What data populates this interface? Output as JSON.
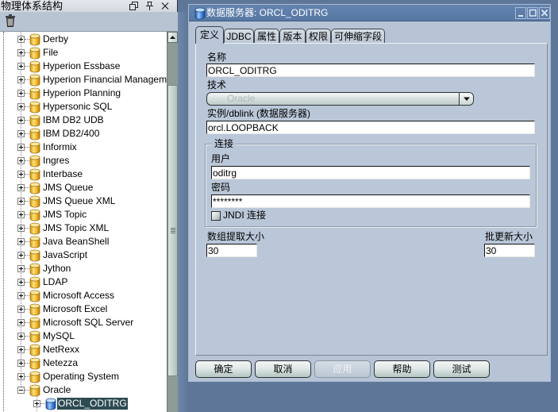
{
  "colors": {
    "desktop_bg": "#5e7799",
    "dialog_bg": "#b6c4d6",
    "title_bar": "#5878a4",
    "selection_bg": "#2c4a52",
    "technology_icon": "#f0b428",
    "data_server_icon": "#3c78d8"
  },
  "left_panel": {
    "title": "物理体系结构",
    "header_icons": {
      "restore": "restore-window-icon",
      "pin": "pin-icon",
      "close": "close-icon"
    },
    "toolbar": {
      "delete": "trash-icon"
    },
    "tree": {
      "items": [
        {
          "label": "Derby",
          "level": 1,
          "expander": "plus",
          "icon": "technology-icon"
        },
        {
          "label": "File",
          "level": 1,
          "expander": "plus",
          "icon": "technology-icon"
        },
        {
          "label": "Hyperion Essbase",
          "level": 1,
          "expander": "plus",
          "icon": "technology-icon"
        },
        {
          "label": "Hyperion Financial Management",
          "level": 1,
          "expander": "plus",
          "icon": "technology-icon"
        },
        {
          "label": "Hyperion Planning",
          "level": 1,
          "expander": "plus",
          "icon": "technology-icon"
        },
        {
          "label": "Hypersonic SQL",
          "level": 1,
          "expander": "plus",
          "icon": "technology-icon"
        },
        {
          "label": "IBM DB2 UDB",
          "level": 1,
          "expander": "plus",
          "icon": "technology-icon"
        },
        {
          "label": "IBM DB2/400",
          "level": 1,
          "expander": "plus",
          "icon": "technology-icon"
        },
        {
          "label": "Informix",
          "level": 1,
          "expander": "plus",
          "icon": "technology-icon"
        },
        {
          "label": "Ingres",
          "level": 1,
          "expander": "plus",
          "icon": "technology-icon"
        },
        {
          "label": "Interbase",
          "level": 1,
          "expander": "plus",
          "icon": "technology-icon"
        },
        {
          "label": "JMS Queue",
          "level": 1,
          "expander": "plus",
          "icon": "technology-icon"
        },
        {
          "label": "JMS Queue XML",
          "level": 1,
          "expander": "plus",
          "icon": "technology-icon"
        },
        {
          "label": "JMS Topic",
          "level": 1,
          "expander": "plus",
          "icon": "technology-icon"
        },
        {
          "label": "JMS Topic XML",
          "level": 1,
          "expander": "plus",
          "icon": "technology-icon"
        },
        {
          "label": "Java BeanShell",
          "level": 1,
          "expander": "plus",
          "icon": "technology-icon"
        },
        {
          "label": "JavaScript",
          "level": 1,
          "expander": "plus",
          "icon": "technology-icon"
        },
        {
          "label": "Jython",
          "level": 1,
          "expander": "plus",
          "icon": "technology-icon"
        },
        {
          "label": "LDAP",
          "level": 1,
          "expander": "plus",
          "icon": "technology-icon"
        },
        {
          "label": "Microsoft Access",
          "level": 1,
          "expander": "plus",
          "icon": "technology-icon"
        },
        {
          "label": "Microsoft Excel",
          "level": 1,
          "expander": "plus",
          "icon": "technology-icon"
        },
        {
          "label": "Microsoft SQL Server",
          "level": 1,
          "expander": "plus",
          "icon": "technology-icon"
        },
        {
          "label": "MySQL",
          "level": 1,
          "expander": "plus",
          "icon": "technology-icon"
        },
        {
          "label": "NetRexx",
          "level": 1,
          "expander": "plus",
          "icon": "technology-icon"
        },
        {
          "label": "Netezza",
          "level": 1,
          "expander": "plus",
          "icon": "technology-icon"
        },
        {
          "label": "Operating System",
          "level": 1,
          "expander": "plus",
          "icon": "technology-icon"
        },
        {
          "label": "Oracle",
          "level": 1,
          "expander": "minus",
          "icon": "technology-icon"
        },
        {
          "label": "ORCL_ODITRG",
          "level": 2,
          "expander": "plus",
          "icon": "data-server-icon",
          "selected": true
        }
      ]
    },
    "scrollbar": {
      "visible_fraction": 0.79,
      "scroll_offset_fraction": 0.114
    }
  },
  "dialog": {
    "title": "数据服务器: ORCL_ODITRG",
    "title_icon": "data-server-icon",
    "window_controls": {
      "minimize": "minimize-icon",
      "maximize": "maximize-icon",
      "close": "close-icon"
    },
    "tabs": [
      {
        "label": "定义",
        "active": true
      },
      {
        "label": "JDBC",
        "active": false
      },
      {
        "label": "属性",
        "active": false
      },
      {
        "label": "版本",
        "active": false
      },
      {
        "label": "权限",
        "active": false
      },
      {
        "label": "可伸缩字段",
        "active": false
      }
    ],
    "definition": {
      "name": {
        "label": "名称",
        "value": "ORCL_ODITRG"
      },
      "technology": {
        "label": "技术",
        "value": "Oracle",
        "disabled": true
      },
      "instance": {
        "label": "实例/dblink (数据服务器)",
        "value": "orcl.LOOPBACK"
      },
      "connection": {
        "legend": "连接",
        "user": {
          "label": "用户",
          "value": "oditrg"
        },
        "password": {
          "label": "密码",
          "value": "********"
        },
        "jndi": {
          "label": "JNDI 连接",
          "checked": false
        }
      },
      "array_fetch_size": {
        "label": "数组提取大小",
        "value": "30"
      },
      "batch_update_size": {
        "label": "批更新大小",
        "value": "30"
      }
    },
    "buttons": [
      {
        "label": "确定",
        "disabled": false
      },
      {
        "label": "取消",
        "disabled": false
      },
      {
        "label": "应用",
        "disabled": true
      },
      {
        "label": "帮助",
        "disabled": false
      },
      {
        "label": "测试",
        "disabled": false
      }
    ]
  }
}
